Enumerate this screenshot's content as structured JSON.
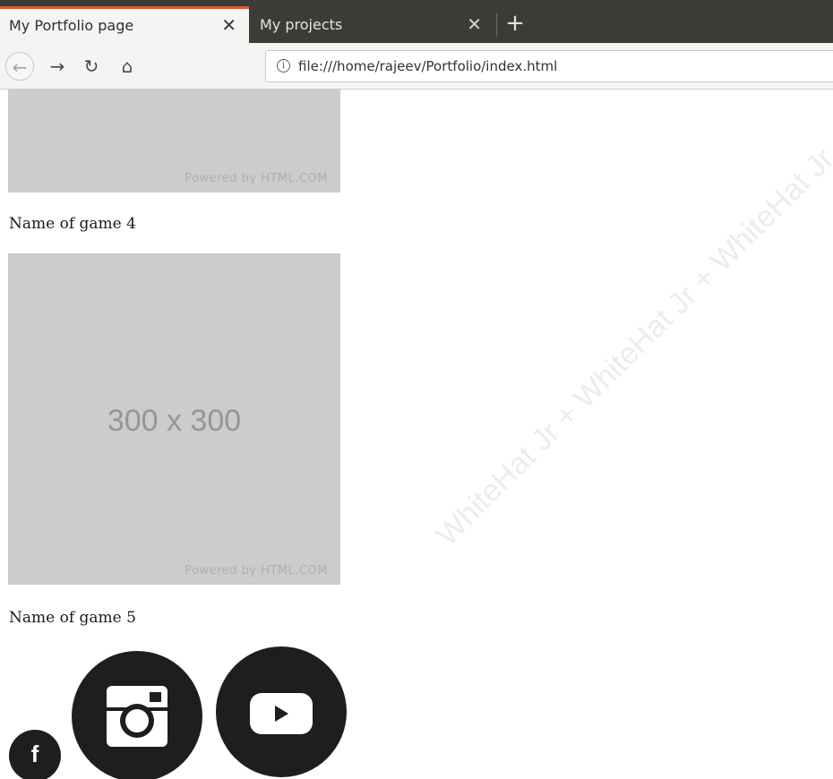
{
  "browser": {
    "tabs": [
      {
        "title": "My Portfolio page",
        "close": "✕"
      },
      {
        "title": "My projects",
        "close": "✕"
      }
    ],
    "new_tab": "+",
    "nav": {
      "back": "←",
      "forward": "→",
      "reload": "↻",
      "home": "⌂"
    },
    "url": "file:///home/rajeev/Portfolio/index.html",
    "info_glyph": "i"
  },
  "page": {
    "placeholder_top": {
      "powered": "Powered by HTML.COM"
    },
    "games": [
      {
        "name": "Name of game 4"
      },
      {
        "name": "Name of game 5"
      }
    ],
    "placeholder_main": {
      "size": "300 x 300",
      "powered": "Powered by HTML.COM"
    },
    "social": {
      "facebook": {
        "icon": "facebook-icon",
        "glyph": "f"
      },
      "instagram": {
        "icon": "instagram-icon"
      },
      "youtube": {
        "icon": "youtube-icon"
      }
    }
  },
  "watermark": "WhiteHat Jr + WhiteHat Jr + WhiteHat Jr",
  "colors": {
    "tab_accent": "#e95420",
    "tabbar_bg": "#3d3b37",
    "placeholder_bg": "#cccccc",
    "icon_bg": "#1e1e1e"
  }
}
